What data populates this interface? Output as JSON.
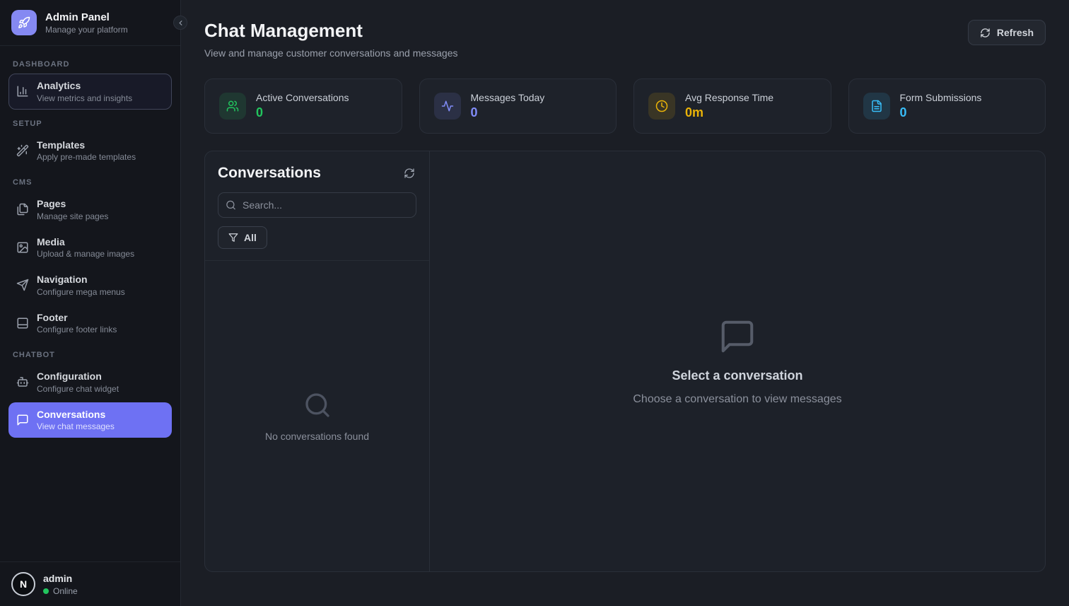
{
  "sidebar": {
    "brand": {
      "title": "Admin Panel",
      "subtitle": "Manage your platform"
    },
    "sections": [
      {
        "label": "DASHBOARD",
        "items": [
          {
            "title": "Analytics",
            "subtitle": "View metrics and insights"
          }
        ]
      },
      {
        "label": "SETUP",
        "items": [
          {
            "title": "Templates",
            "subtitle": "Apply pre-made templates"
          }
        ]
      },
      {
        "label": "CMS",
        "items": [
          {
            "title": "Pages",
            "subtitle": "Manage site pages"
          },
          {
            "title": "Media",
            "subtitle": "Upload & manage images"
          },
          {
            "title": "Navigation",
            "subtitle": "Configure mega menus"
          },
          {
            "title": "Footer",
            "subtitle": "Configure footer links"
          }
        ]
      },
      {
        "label": "CHATBOT",
        "items": [
          {
            "title": "Configuration",
            "subtitle": "Configure chat widget"
          },
          {
            "title": "Conversations",
            "subtitle": "View chat messages"
          }
        ]
      }
    ],
    "user": {
      "initial": "N",
      "name": "admin",
      "status": "Online"
    }
  },
  "header": {
    "title": "Chat Management",
    "subtitle": "View and manage customer conversations and messages",
    "refresh_label": "Refresh"
  },
  "stats": [
    {
      "label": "Active Conversations",
      "value": "0",
      "color": "#22c55e"
    },
    {
      "label": "Messages Today",
      "value": "0",
      "color": "#818cf8"
    },
    {
      "label": "Avg Response Time",
      "value": "0m",
      "color": "#eab308"
    },
    {
      "label": "Form Submissions",
      "value": "0",
      "color": "#38bdf8"
    }
  ],
  "conversations": {
    "title": "Conversations",
    "search_placeholder": "Search...",
    "filter_label": "All",
    "empty_text": "No conversations found"
  },
  "detail": {
    "title": "Select a conversation",
    "subtitle": "Choose a conversation to view messages"
  },
  "theme": {
    "accent": "#6e71f3",
    "sidebar_bg": "#14161c",
    "main_bg": "#1b1e25",
    "card_bg": "#1e222a"
  }
}
